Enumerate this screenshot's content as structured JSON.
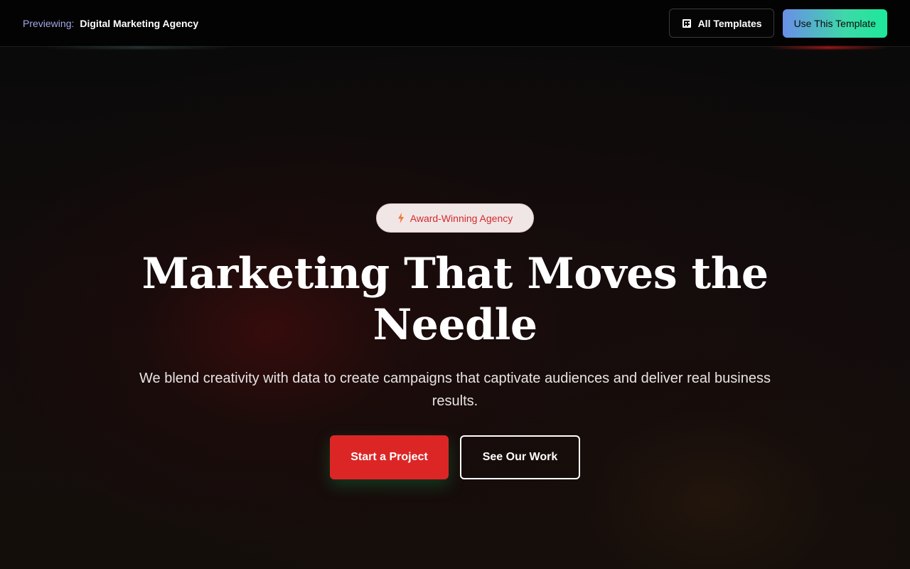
{
  "topbar": {
    "previewing_label": "Previewing:",
    "template_name": "Digital Marketing Agency",
    "all_templates_label": "All Templates",
    "all_templates_icon": "grid-icon",
    "use_template_label": "Use This Template"
  },
  "hero": {
    "badge": {
      "icon": "lightning-bolt-icon",
      "label": "Award-Winning Agency"
    },
    "headline": "Marketing That Moves the Needle",
    "subtext": "We blend creativity with data to create campaigns that captivate audiences and deliver real business results.",
    "primary_cta": "Start a Project",
    "secondary_cta": "See Our Work"
  },
  "colors": {
    "accent_red": "#dc2626",
    "gradient_start": "#6a8ee8",
    "gradient_end": "#1de89a",
    "badge_bg": "#f1e6e6",
    "badge_text": "#d42a2a"
  }
}
